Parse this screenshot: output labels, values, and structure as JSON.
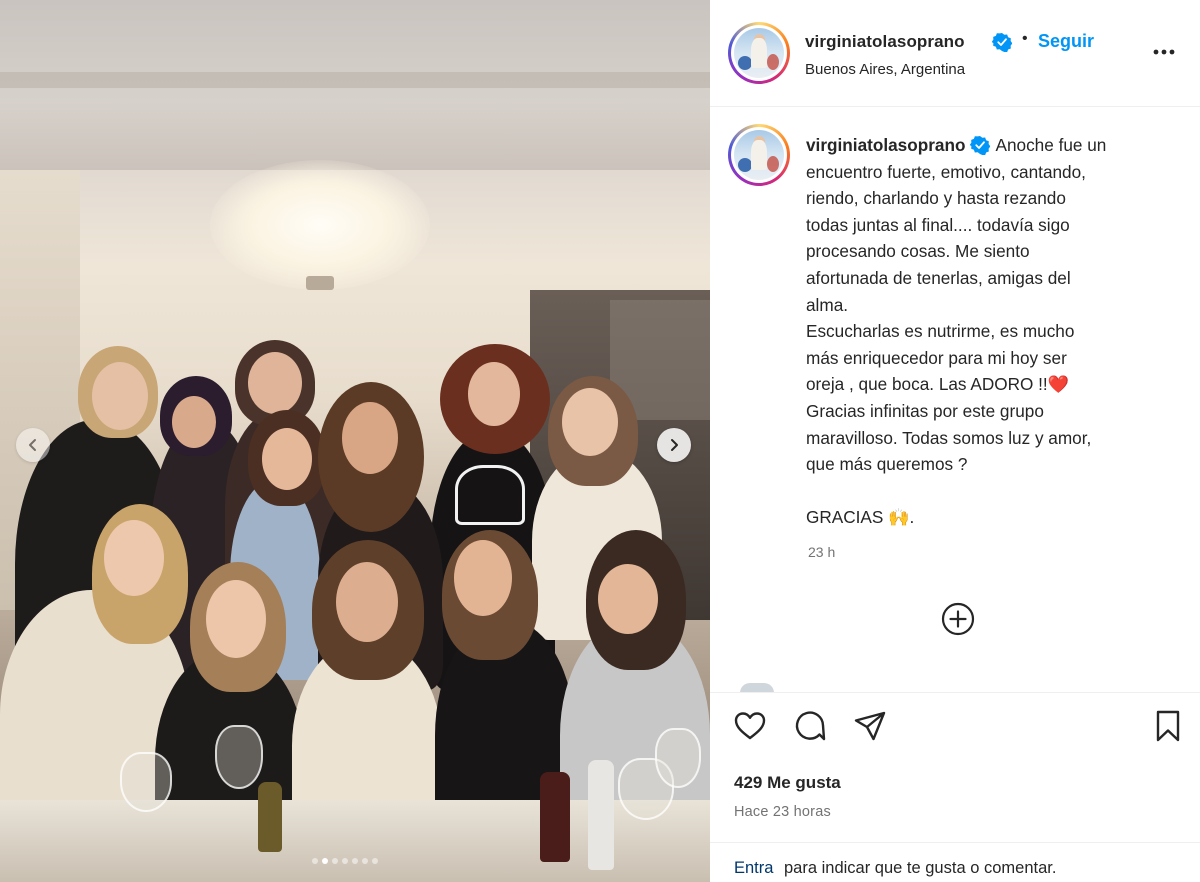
{
  "post": {
    "username": "virginiatolasoprano",
    "location": "Buenos Aires, Argentina",
    "follow_label": "Seguir",
    "bullet": "•",
    "caption_lines": [
      "Anoche fue un",
      "encuentro fuerte, emotivo, cantando,",
      "riendo, charlando y hasta rezando",
      "todas juntas al final.... todavía sigo",
      "procesando cosas. Me siento",
      "afortunada de tenerlas, amigas del",
      "alma.",
      "Escucharlas es nutrirme, es mucho",
      "más enriquecedor para mi hoy ser",
      "oreja , que boca. Las ADORO !!❤️",
      "Gracias infinitas por este grupo",
      "maravilloso. Todas somos luz y amor,",
      "que más queremos ?",
      "",
      "GRACIAS 🙌."
    ],
    "caption_time": "23 h",
    "likes": "429 Me gusta",
    "posted_ago": "Hace 23 horas",
    "comment_prompt_link": "Entra",
    "comment_prompt_rest": "para indicar que te gusta o comentar."
  },
  "carousel": {
    "slide_count": 7,
    "active_index": 1
  },
  "icons": {
    "verified": "verified-badge-icon",
    "more": "more-horizontal-icon",
    "like": "heart-icon",
    "comment": "comment-bubble-icon",
    "share": "paper-plane-icon",
    "save": "bookmark-icon",
    "add_comment": "plus-circle-icon",
    "prev": "chevron-left-icon",
    "next": "chevron-right-icon"
  },
  "colors": {
    "link_blue": "#0095f6",
    "verified_blue": "#0095f6",
    "text": "#262626",
    "muted": "#737373",
    "dark_link": "#00376b",
    "heart_red": "#ed1c3a"
  }
}
